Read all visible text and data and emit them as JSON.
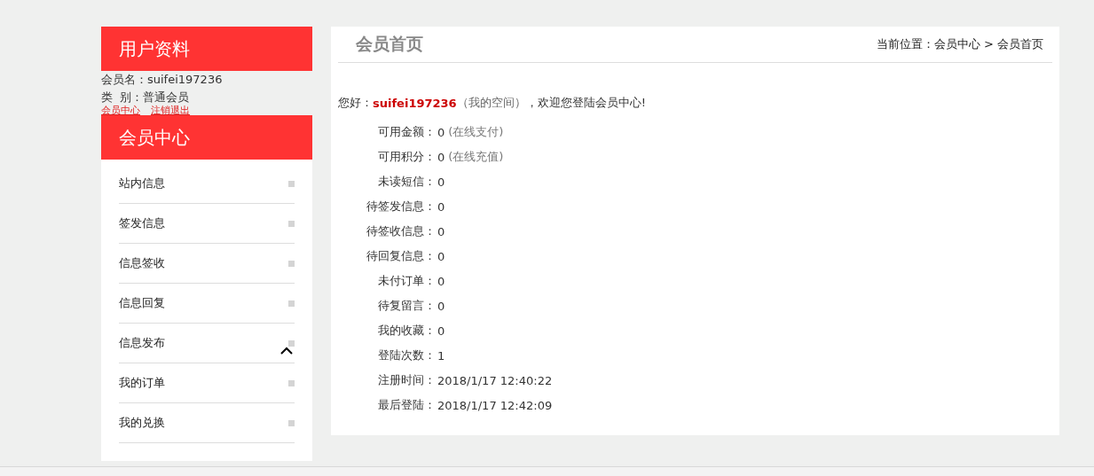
{
  "profile": {
    "title": "用户资料",
    "fields": [
      {
        "label": "会员名：",
        "value": "suifei197236"
      },
      {
        "label": "类  别：",
        "value": "普通会员"
      }
    ],
    "links": [
      "会员中心",
      "注销退出"
    ]
  },
  "member_center": {
    "title": "会员中心",
    "items": [
      {
        "label": "站内信息",
        "cursor": false
      },
      {
        "label": "签发信息",
        "cursor": false
      },
      {
        "label": "信息签收",
        "cursor": false
      },
      {
        "label": "信息回复",
        "cursor": false
      },
      {
        "label": "信息发布",
        "cursor": true
      },
      {
        "label": "我的订单",
        "cursor": false
      },
      {
        "label": "我的兑换",
        "cursor": false
      }
    ]
  },
  "main": {
    "title": "会员首页",
    "breadcrumb": "当前位置：会员中心 > 会员首页",
    "greeting": {
      "prefix": "您好：",
      "username": "suifei197236",
      "space_link": "（我的空间）",
      "suffix": "，欢迎您登陆会员中心!"
    },
    "stats": [
      {
        "label": "可用金额：",
        "value": "0",
        "action": "(在线支付)"
      },
      {
        "label": "可用积分：",
        "value": "0",
        "action": "(在线充值)"
      },
      {
        "label": "未读短信：",
        "value": "0"
      },
      {
        "label": "待签发信息：",
        "value": "0"
      },
      {
        "label": "待签收信息：",
        "value": "0"
      },
      {
        "label": "待回复信息：",
        "value": "0"
      },
      {
        "label": "未付订单：",
        "value": "0"
      },
      {
        "label": "待复留言：",
        "value": "0"
      },
      {
        "label": "我的收藏：",
        "value": "0"
      },
      {
        "label": "登陆次数：",
        "value": "1"
      },
      {
        "label": "注册时间：",
        "value": "2018/1/17 12:40:22"
      },
      {
        "label": "最后登陆：",
        "value": "2018/1/17 12:42:09"
      }
    ]
  }
}
